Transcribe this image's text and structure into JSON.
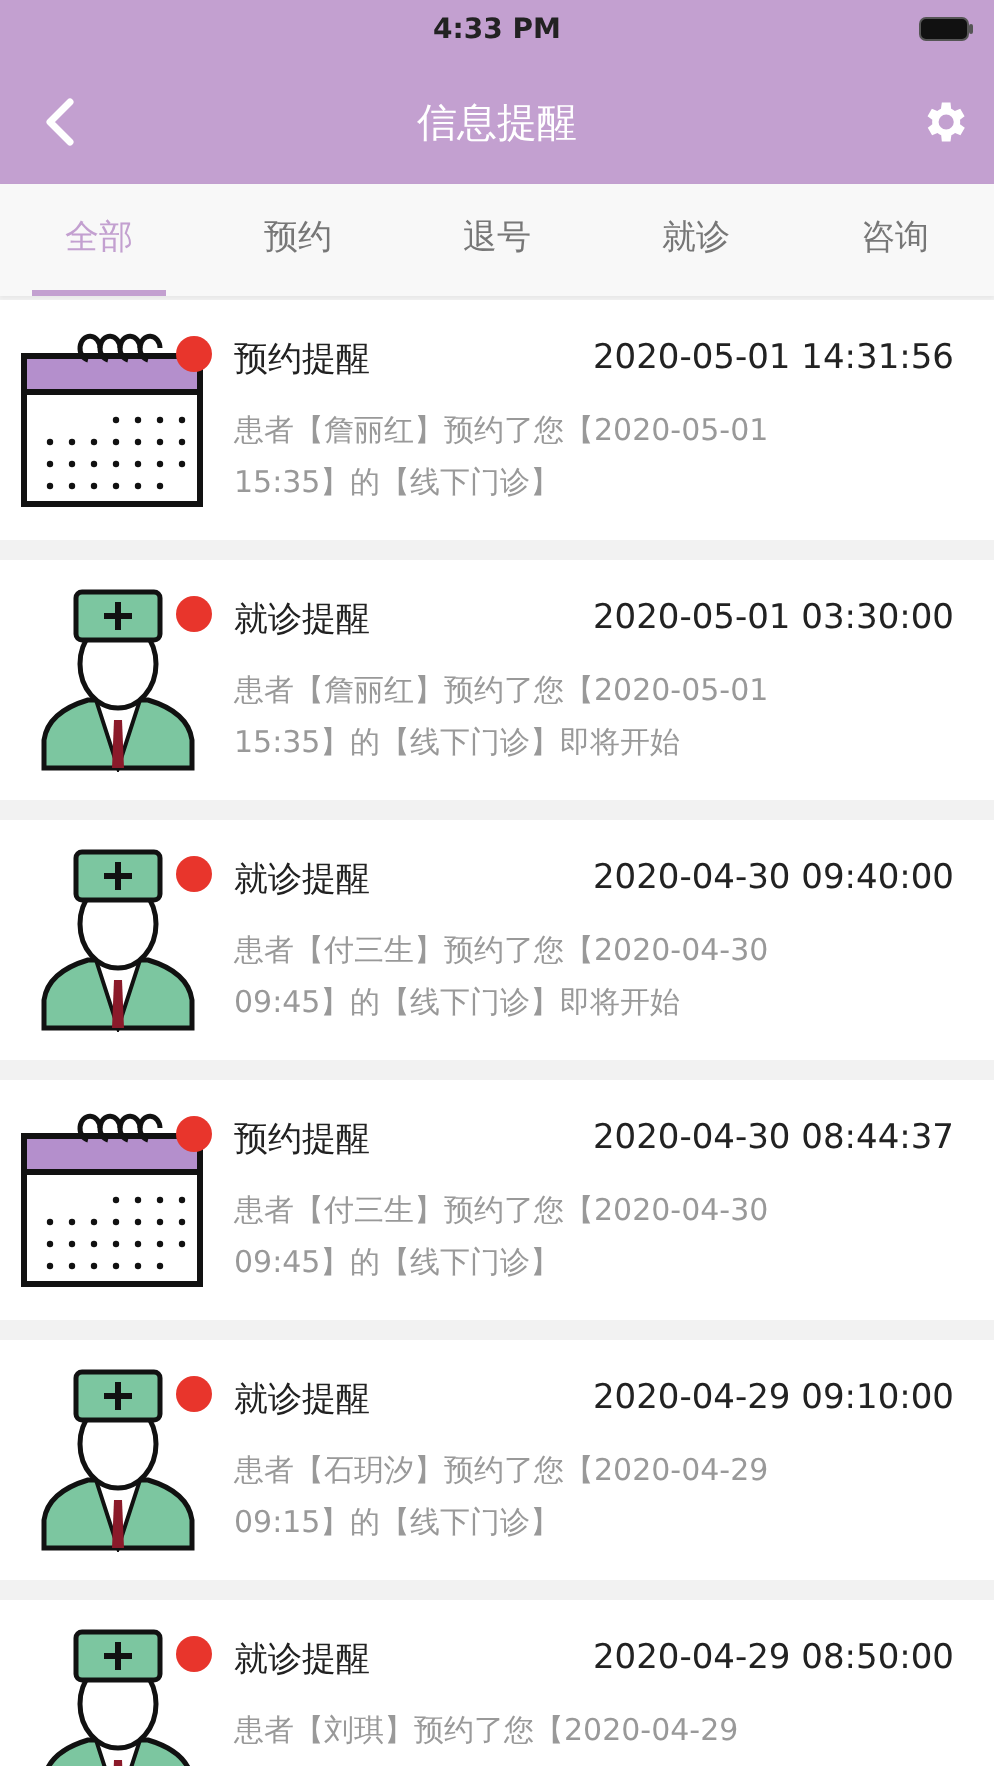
{
  "status_bar": {
    "time": "4:33 PM"
  },
  "nav": {
    "title": "信息提醒"
  },
  "tabs": [
    {
      "label": "全部",
      "selected": true
    },
    {
      "label": "预约",
      "selected": false
    },
    {
      "label": "退号",
      "selected": false
    },
    {
      "label": "就诊",
      "selected": false
    },
    {
      "label": "咨询",
      "selected": false
    }
  ],
  "messages": [
    {
      "kind": "appointment",
      "unread": true,
      "title": "预约提醒",
      "time": "2020-05-01 14:31:56",
      "text": "患者【詹丽红】预约了您【2020-05-01 15:35】的【线下门诊】"
    },
    {
      "kind": "visit",
      "unread": true,
      "title": "就诊提醒",
      "time": "2020-05-01 03:30:00",
      "text": "患者【詹丽红】预约了您【2020-05-01 15:35】的【线下门诊】即将开始"
    },
    {
      "kind": "visit",
      "unread": true,
      "title": "就诊提醒",
      "time": "2020-04-30 09:40:00",
      "text": "患者【付三生】预约了您【2020-04-30 09:45】的【线下门诊】即将开始"
    },
    {
      "kind": "appointment",
      "unread": true,
      "title": "预约提醒",
      "time": "2020-04-30 08:44:37",
      "text": "患者【付三生】预约了您【2020-04-30 09:45】的【线下门诊】"
    },
    {
      "kind": "visit",
      "unread": true,
      "title": "就诊提醒",
      "time": "2020-04-29 09:10:00",
      "text": "患者【石玥汐】预约了您【2020-04-29 09:15】的【线下门诊】"
    },
    {
      "kind": "visit",
      "unread": true,
      "title": "就诊提醒",
      "time": "2020-04-29 08:50:00",
      "text": "患者【刘琪】预约了您【2020-04-29"
    }
  ]
}
